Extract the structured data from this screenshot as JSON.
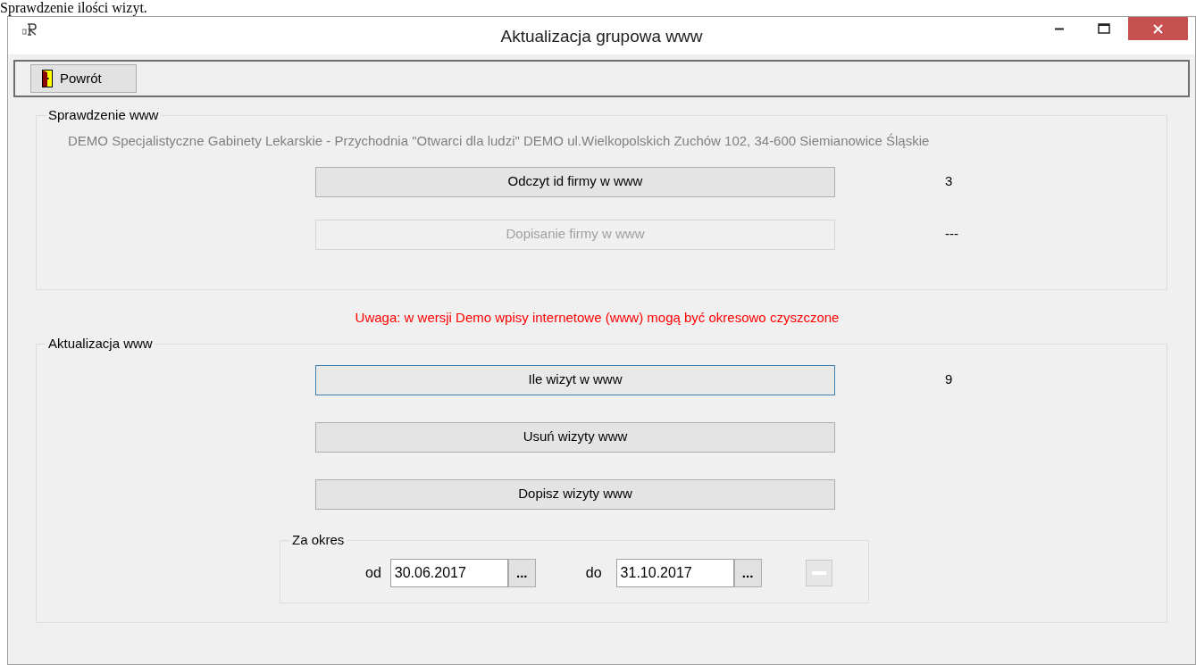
{
  "document_heading": "Sprawdzenie ilości wizyt.",
  "window": {
    "title": "Aktualizacja grupowa www",
    "controls": [
      {
        "kind": "minimize"
      },
      {
        "kind": "maximize"
      },
      {
        "kind": "close"
      }
    ]
  },
  "toolbar": {
    "back_button": "Powrót"
  },
  "check_group": {
    "title": "Sprawdzenie www",
    "company": "DEMO Specjalistyczne Gabinety Lekarskie - Przychodnia \"Otwarci dla ludzi\" DEMO ul.Wielkopolskich Zuchów 102, 34-600 Siemianowice Śląskie",
    "rows": [
      {
        "button": "Odczyt id firmy w www",
        "disabled": false,
        "focused": false,
        "value": "3"
      },
      {
        "button": "Dopisanie firmy w www",
        "disabled": true,
        "focused": false,
        "value": "---"
      }
    ]
  },
  "warning": "Uwaga: w wersji Demo wpisy internetowe (www) mogą być okresowo czyszczone",
  "update_group": {
    "title": "Aktualizacja www",
    "rows": [
      {
        "button": "Ile wizyt w www",
        "disabled": false,
        "focused": true,
        "value": "9"
      },
      {
        "button": "Usuń wizyty www",
        "disabled": false,
        "focused": false
      },
      {
        "button": "Dopisz wizyty www",
        "disabled": false,
        "focused": false
      }
    ],
    "period": {
      "title": "Za okres",
      "from_label": "od",
      "from_value": "30.06.2017",
      "from_picker": "...",
      "to_label": "do",
      "to_value": "31.10.2017",
      "to_picker": "..."
    }
  }
}
